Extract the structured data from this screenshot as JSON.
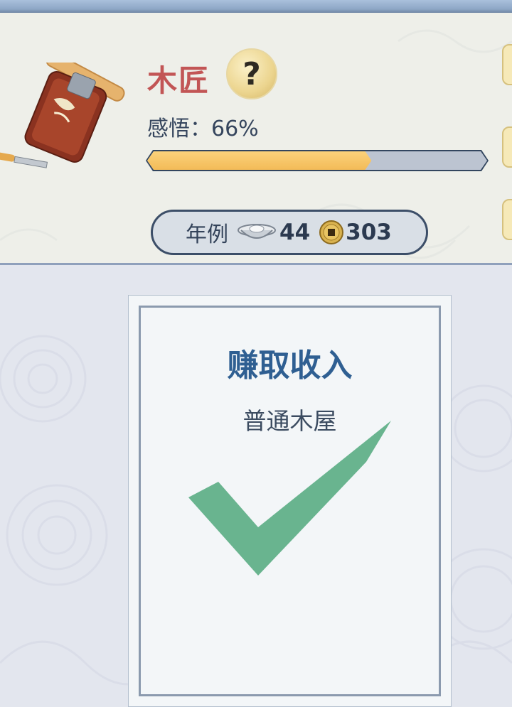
{
  "profession": {
    "title": "木匠",
    "help_symbol": "?",
    "insight_text": "感悟：66%",
    "insight_progress": 0.66
  },
  "stipend": {
    "label": "年例",
    "silver": "44",
    "copper": "303",
    "silver_icon": "silver-ingot-icon",
    "copper_icon": "copper-coin-icon"
  },
  "card": {
    "title": "赚取收入",
    "subtitle": "普通木屋",
    "status_icon": "checkmark-icon"
  },
  "colors": {
    "title_red": "#c25555",
    "card_title_blue": "#2f5f92",
    "progress_fill": "#f3bb58",
    "check_green": "#69b48f"
  }
}
